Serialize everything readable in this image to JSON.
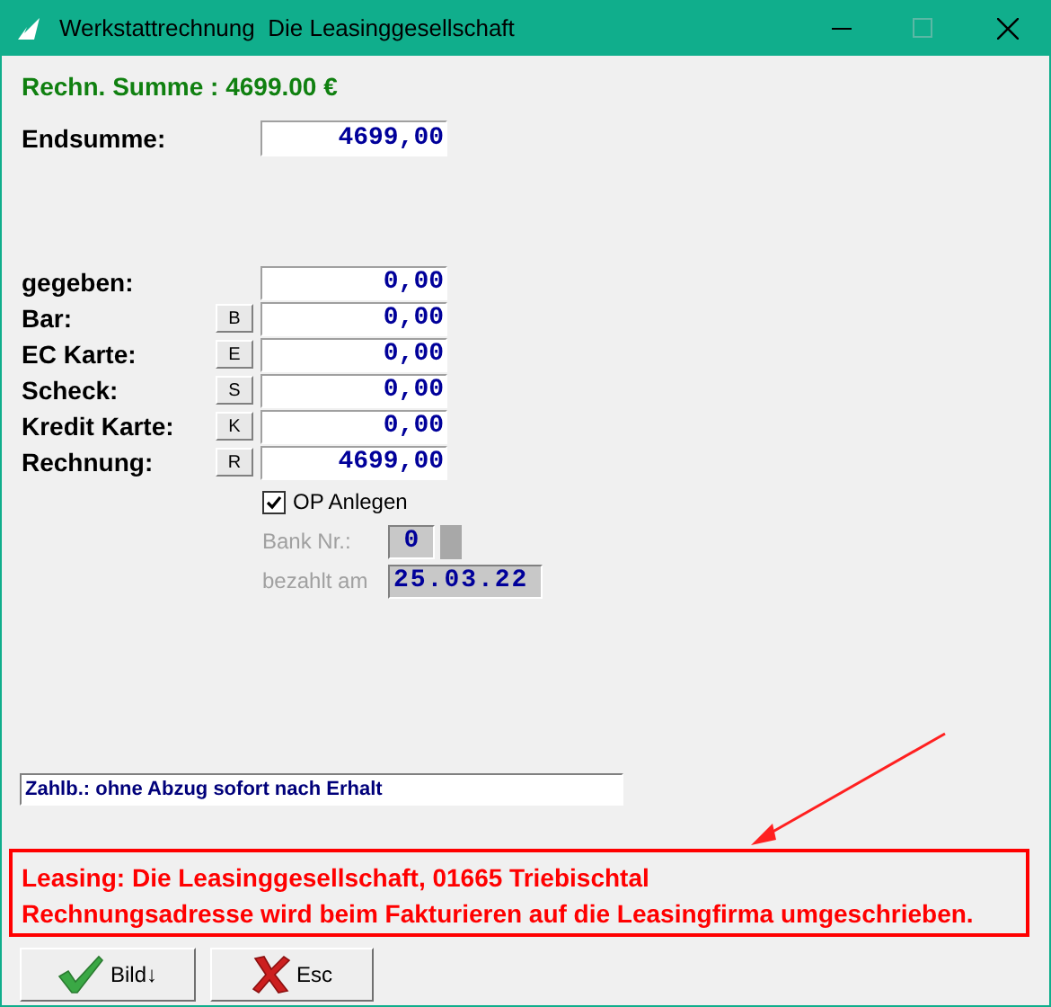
{
  "window": {
    "title": "Werkstattrechnung  Die Leasinggesellschaft"
  },
  "invoice_total": "Rechn. Summe : 4699.00 €",
  "end_sum": {
    "label": "Endsumme:",
    "value": "4699,00"
  },
  "payments": [
    {
      "label": "gegeben:",
      "value": "0,00"
    },
    {
      "label": "Bar:",
      "key": "B",
      "value": "0,00"
    },
    {
      "label": "EC Karte:",
      "key": "E",
      "value": "0,00"
    },
    {
      "label": "Scheck:",
      "key": "S",
      "value": "0,00"
    },
    {
      "label": "Kredit Karte:",
      "key": "K",
      "value": "0,00"
    },
    {
      "label": "Rechnung:",
      "key": "R",
      "value": "4699,00"
    }
  ],
  "op_anlegen": {
    "label": "OP Anlegen",
    "checked": true
  },
  "bank_nr": {
    "label": "Bank Nr.:",
    "value": "0",
    "disabled": true
  },
  "paid_on": {
    "label": "bezahlt am",
    "value": "25.03.22",
    "disabled": true
  },
  "payment_terms": "Zahlb.: ohne Abzug sofort nach Erhalt",
  "notice": [
    "Leasing: Die Leasinggesellschaft, 01665 Triebischtal",
    "Rechnungsadresse wird beim Fakturieren auf die Leasingfirma umgeschrieben."
  ],
  "buttons": [
    {
      "label": "Bild↓",
      "kind": "ok"
    },
    {
      "label": "Esc",
      "kind": "cancel"
    }
  ]
}
